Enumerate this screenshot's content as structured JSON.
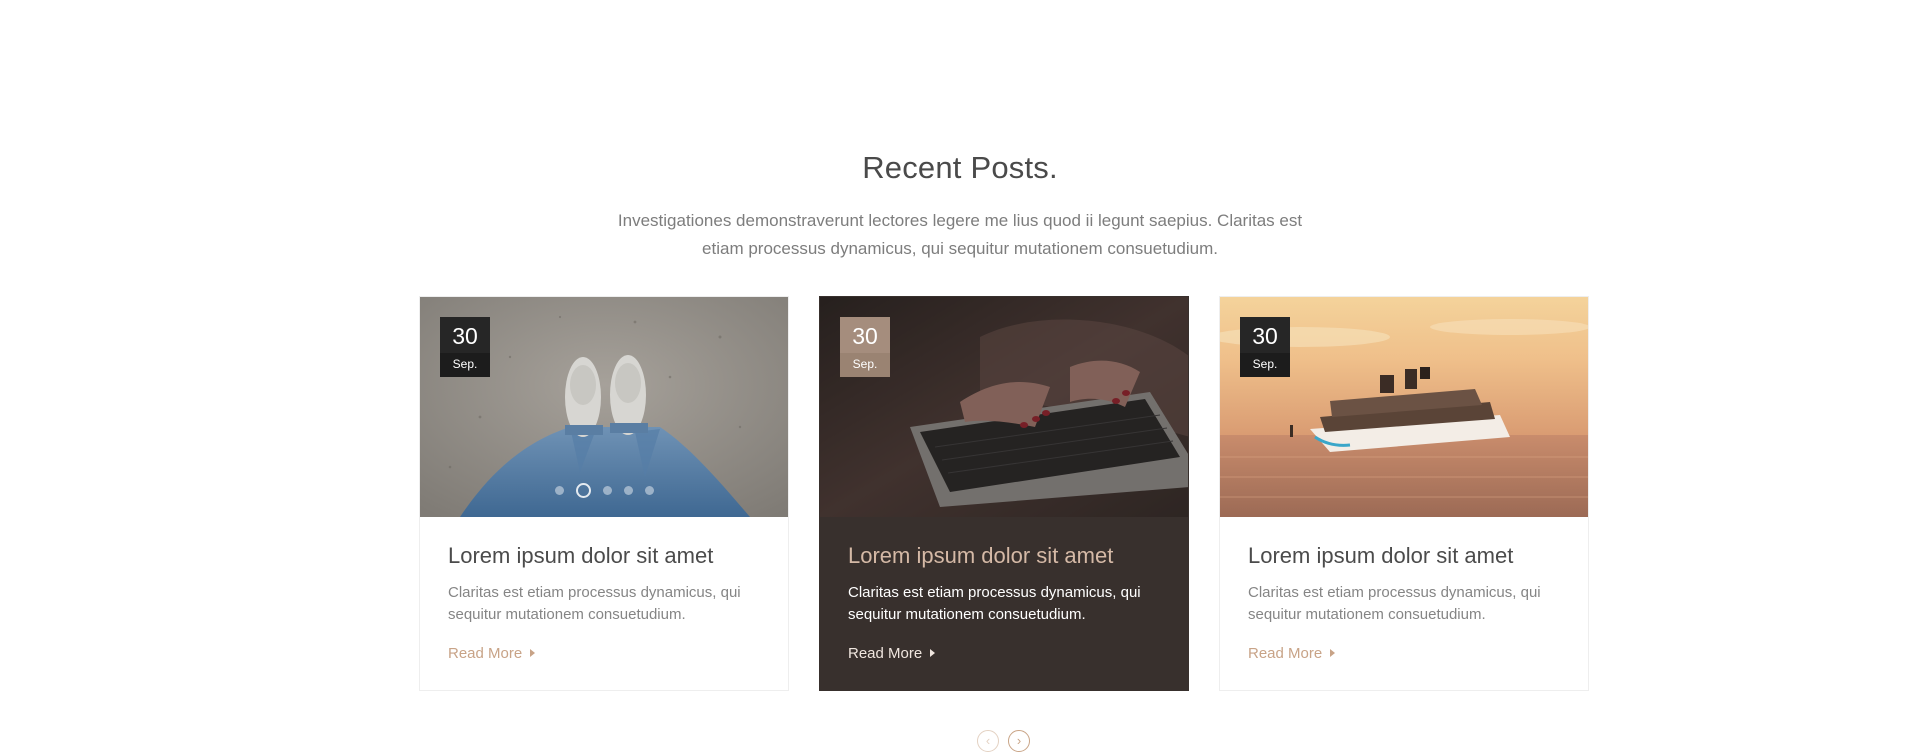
{
  "section": {
    "title": "Recent Posts.",
    "subtitle": "Investigationes demonstraverunt lectores legere me lius quod ii legunt saepius. Claritas est etiam processus dynamicus, qui sequitur mutationem consuetudium."
  },
  "posts": [
    {
      "date_day": "30",
      "date_month": "Sep.",
      "image": "feet-on-sand",
      "title": "Lorem ipsum dolor sit amet",
      "excerpt": "Claritas est etiam processus dynamicus, qui sequitur mutationem consuetudium.",
      "read_more": "Read More",
      "slider_dots": 5,
      "active_dot": 2
    },
    {
      "date_day": "30",
      "date_month": "Sep.",
      "image": "hands-on-laptop",
      "title": "Lorem ipsum dolor sit amet",
      "excerpt": "Claritas est etiam processus dynamicus, qui sequitur mutationem consuetudium.",
      "read_more": "Read More",
      "highlighted": true
    },
    {
      "date_day": "30",
      "date_month": "Sep.",
      "image": "cruise-ship-sunset",
      "title": "Lorem ipsum dolor sit amet",
      "excerpt": "Claritas est etiam processus dynamicus, qui sequitur mutationem consuetudium.",
      "read_more": "Read More"
    }
  ],
  "carousel": {
    "prev_icon": "chevron-left-icon",
    "next_icon": "chevron-right-icon"
  },
  "colors": {
    "accent": "#c8a387",
    "dark_card": "#38302d",
    "date_badge": "#262626",
    "date_badge_highlight": "#a58d7d"
  }
}
